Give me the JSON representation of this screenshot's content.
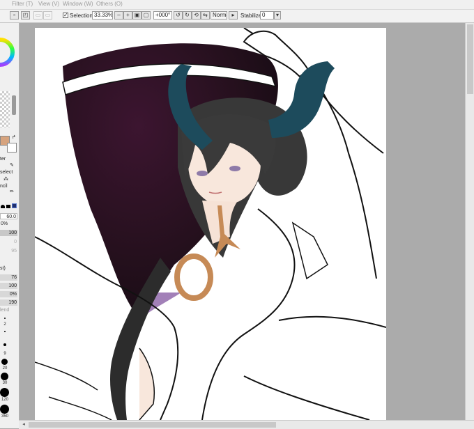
{
  "menu": {
    "filter": "Filter (T)",
    "view": "View (V)",
    "window": "Window (W)",
    "others": "Others (O)"
  },
  "toolbar": {
    "selection_label": "Selection",
    "selection_checked": true,
    "zoom": "33.33%",
    "rotation": "+000°",
    "blend_mode": "Normal",
    "stabilizer_label": "Stabilizer",
    "stabilizer_value": "0"
  },
  "left_panel": {
    "tool_labels": [
      "ter",
      "select",
      "ncil"
    ],
    "brush_size": "60.0",
    "density": "0%",
    "values": [
      "100",
      "0",
      "95"
    ],
    "mode_label": "st)",
    "params": [
      "76",
      "100",
      "0%",
      "190"
    ],
    "blend_label": "lend",
    "brush_sizes": [
      "2",
      "9",
      "20",
      "30",
      "120",
      "350"
    ]
  },
  "colors": {
    "primary": "#d6a37e",
    "secondary": "#ffffff",
    "cloak": "#2a1022",
    "horns": "#1d4b5c",
    "hair": "#383838",
    "pendant": "#c68a56",
    "skin": "#f8e7dc"
  }
}
